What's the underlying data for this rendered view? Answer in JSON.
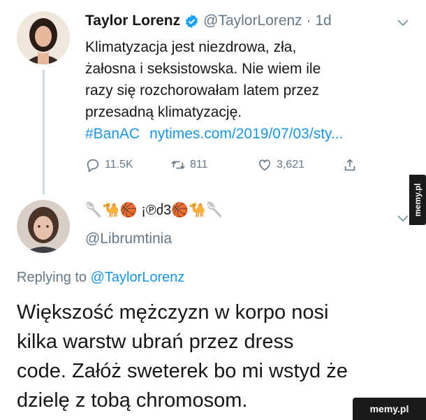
{
  "tweet1": {
    "name": "Taylor Lorenz",
    "handle_time": "@TaylorLorenz · 1d",
    "text_lines": [
      "Klimatyzacja jest niezdrowa, zła,",
      "żałosna i seksistowska. Nie wiem ile",
      "razy się rozchorowałam latem przez",
      "przesadną klimatyzację."
    ],
    "hashtag": "#BanAC",
    "link": "nytimes.com/2019/07/03/sty...",
    "replies": "11.5K",
    "retweets": "811",
    "likes": "3,621"
  },
  "tweet2": {
    "name_emoji": "🥄🐪🏀 ¡℗ძ3🏀🐪🥄",
    "handle": "@Librumtinia",
    "replying_prefix": "Replying to",
    "replying_to": "@TaylorLorenz",
    "text_lines": [
      "Większość mężczyzn w korpo nosi",
      "kilka warstw ubrań przez dress",
      "code. Załóż sweterek bo mi wstyd że",
      "dzielę z tobą chromosom."
    ]
  },
  "watermarks": {
    "side": "memy.pl",
    "bottom": "memy.pl"
  },
  "colors": {
    "link": "#1b95e0",
    "verified": "#1da1f2",
    "muted": "#657786"
  },
  "icons": [
    "verified-badge-icon",
    "chevron-down-icon",
    "reply-icon",
    "retweet-icon",
    "like-icon",
    "share-icon"
  ]
}
